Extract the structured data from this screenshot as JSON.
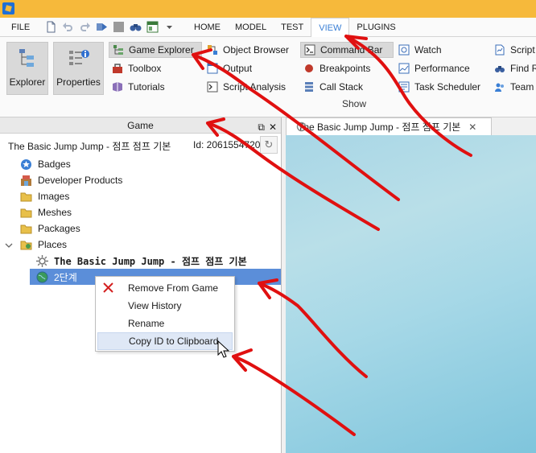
{
  "menubar": {
    "file": "FILE",
    "tabs": [
      "HOME",
      "MODEL",
      "TEST",
      "VIEW",
      "PLUGINS"
    ],
    "active_tab": "VIEW"
  },
  "ribbon": {
    "big_buttons": {
      "explorer": "Explorer",
      "properties": "Properties"
    },
    "col1": [
      "Game Explorer",
      "Toolbox",
      "Tutorials"
    ],
    "col2": [
      "Object Browser",
      "Output",
      "Script Analysis"
    ],
    "col3": [
      "Command Bar",
      "Breakpoints",
      "Call Stack"
    ],
    "col4": [
      "Watch",
      "Performance",
      "Task Scheduler"
    ],
    "col5": [
      "Script P",
      "Find R",
      "Team C"
    ],
    "group_label": "Show"
  },
  "game_panel": {
    "title": "Game",
    "game_name": "The Basic Jump Jump - 점프 점프 기본",
    "game_id": "Id: 2061554720",
    "tree": {
      "badges": "Badges",
      "developer_products": "Developer Products",
      "images": "Images",
      "meshes": "Meshes",
      "packages": "Packages",
      "places": "Places",
      "place_main": "The Basic Jump Jump - 점프 점프 기본",
      "place_2": "2단계"
    }
  },
  "doc_tab": {
    "label": "The Basic Jump Jump - 점프 점프 기본"
  },
  "context_menu": {
    "remove": "Remove From Game",
    "history": "View History",
    "rename": "Rename",
    "copy_id": "Copy ID to Clipboard"
  },
  "colors": {
    "accent": "#3a7fd5",
    "selected_row": "#5b8ed9",
    "titlebar": "#f6b93b",
    "annotation": "#e01010"
  }
}
